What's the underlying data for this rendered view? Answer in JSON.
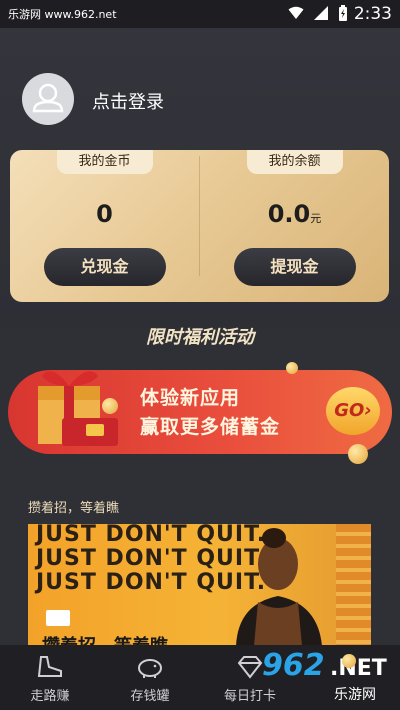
{
  "status_bar": {
    "watermark": "乐游网 www.962.net",
    "time": "2:33",
    "icons": [
      "wifi-icon",
      "signal-icon",
      "battery-icon"
    ]
  },
  "profile": {
    "login_text": "点击登录",
    "avatar_icon": "user-avatar-icon"
  },
  "wallet": {
    "coins_label": "我的金币",
    "coins_value": "0",
    "coins_button": "兑现金",
    "balance_label": "我的余额",
    "balance_value": "0.0",
    "balance_unit": "元",
    "balance_button": "提现金"
  },
  "activity": {
    "title": "限时福利活动",
    "promo_line1": "体验新应用",
    "promo_line2": "赢取更多储蓄金",
    "go_label": "GO"
  },
  "ad": {
    "caption": "攒着招，等着瞧",
    "lines": [
      "JUST DON'T QUIT.",
      "JUST DON'T QUIT.",
      "JUST DON'T QUIT."
    ],
    "bottom_text": "攒着招，等着瞧"
  },
  "bottom_nav": {
    "items": [
      {
        "label": "走路赚",
        "icon": "shoe-icon"
      },
      {
        "label": "存钱罐",
        "icon": "piggy-bank-icon"
      },
      {
        "label": "每日打卡",
        "icon": "diamond-icon"
      },
      {
        "label": "",
        "icon": "user-icon"
      }
    ]
  },
  "site_watermark": {
    "number": "962",
    "net": ".NET",
    "cn": "乐游网"
  },
  "colors": {
    "accent_gold": "#e8ca96",
    "promo_red": "#e94d3c",
    "bg_dark": "#2f2f36"
  }
}
